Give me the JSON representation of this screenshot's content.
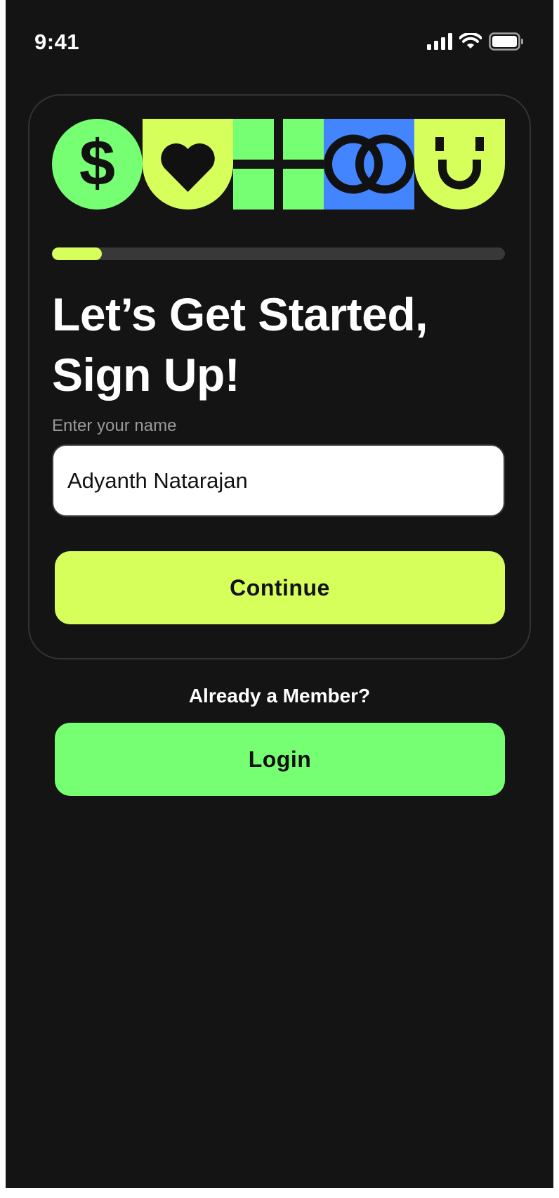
{
  "status_bar": {
    "time": "9:41"
  },
  "progress": {
    "value": 0.11
  },
  "signup": {
    "title_line1": "Let’s Get Started,",
    "title_line2": "Sign Up!",
    "name_label": "Enter your name",
    "name_value": "Adyanth Natarajan",
    "continue_label": "Continue"
  },
  "login": {
    "prompt": "Already a Member?",
    "button_label": "Login"
  },
  "colors": {
    "background": "#141414",
    "lime": "#d7ff5c",
    "green": "#77ff73",
    "blue": "#4285ff"
  }
}
